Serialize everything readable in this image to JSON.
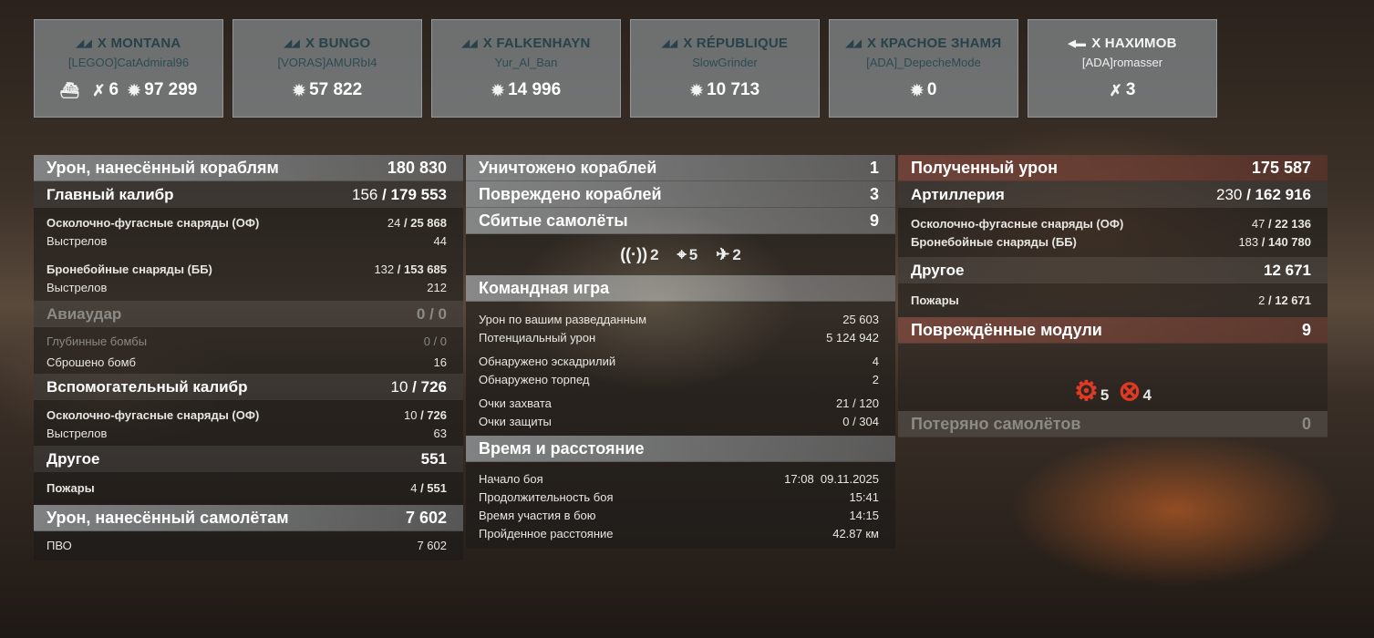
{
  "cards": [
    {
      "tier": "X",
      "ship": "MONTANA",
      "player": "[LEGOO]CatAdmiral96",
      "team": "enemy",
      "class_icon": "battleship-icon",
      "stats": [
        {
          "icon": "sunk-ship-icon",
          "value": ""
        },
        {
          "icon": "plane-shotdown-icon",
          "value": "6"
        },
        {
          "icon": "damage-icon",
          "value": "97 299"
        }
      ]
    },
    {
      "tier": "X",
      "ship": "BUNGO",
      "player": "[VORAS]AMURbI4",
      "team": "enemy",
      "class_icon": "battleship-icon",
      "stats": [
        {
          "icon": "damage-icon",
          "value": "57 822"
        }
      ]
    },
    {
      "tier": "X",
      "ship": "FALKENHAYN",
      "player": "Yur_Al_Ban",
      "team": "enemy",
      "class_icon": "battleship-icon",
      "stats": [
        {
          "icon": "damage-icon",
          "value": "14 996"
        }
      ]
    },
    {
      "tier": "X",
      "ship": "RÉPUBLIQUE",
      "player": "SlowGrinder",
      "team": "enemy",
      "class_icon": "battleship-icon",
      "stats": [
        {
          "icon": "damage-icon",
          "value": "10 713"
        }
      ]
    },
    {
      "tier": "X",
      "ship": "КРАСНОЕ ЗНАМЯ",
      "player": "[ADA]_DepecheMode",
      "team": "enemy",
      "class_icon": "battleship-icon",
      "stats": [
        {
          "icon": "damage-icon",
          "value": "0"
        }
      ]
    },
    {
      "tier": "X",
      "ship": "НАХИМОВ",
      "player": "[ADA]romasser",
      "team": "ally",
      "class_icon": "cruiser-icon",
      "stats": [
        {
          "icon": "plane-shotdown-icon",
          "value": "3"
        }
      ]
    }
  ],
  "left": {
    "h1": {
      "label": "Урон, нанесённый кораблям",
      "value": "180 830"
    },
    "main": {
      "label": "Главный калибр",
      "a": "156",
      "b": "179 553"
    },
    "he": {
      "label": "Осколочно-фугасные снаряды (ОФ)",
      "a": "24",
      "b": "25 868"
    },
    "he_shots": {
      "label": "Выстрелов",
      "value": "44"
    },
    "ap": {
      "label": "Бронебойные снаряды (ББ)",
      "a": "132",
      "b": "153 685"
    },
    "ap_shots": {
      "label": "Выстрелов",
      "value": "212"
    },
    "air": {
      "label": "Авиаудар",
      "value": "0 / 0"
    },
    "depth": {
      "label": "Глубинные бомбы",
      "value": "0 / 0"
    },
    "bombs": {
      "label": "Сброшено бомб",
      "value": "16"
    },
    "sec": {
      "label": "Вспомогательный калибр",
      "a": "10",
      "b": "726"
    },
    "sec_he": {
      "label": "Осколочно-фугасные снаряды (ОФ)",
      "a": "10",
      "b": "726"
    },
    "sec_shots": {
      "label": "Выстрелов",
      "value": "63"
    },
    "other": {
      "label": "Другое",
      "value": "551"
    },
    "fires": {
      "label": "Пожары",
      "a": "4",
      "b": "551"
    },
    "h2": {
      "label": "Урон, нанесённый самолётам",
      "value": "7 602"
    },
    "aa": {
      "label": "ПВО",
      "value": "7 602"
    }
  },
  "mid": {
    "destroyed": {
      "label": "Уничтожено кораблей",
      "value": "1"
    },
    "damaged": {
      "label": "Повреждено кораблей",
      "value": "3"
    },
    "planes": {
      "label": "Сбитые самолёты",
      "value": "9"
    },
    "icons": [
      {
        "icon": "radar-icon",
        "value": "2"
      },
      {
        "icon": "crosshair-icon",
        "value": "5"
      },
      {
        "icon": "fighter-icon",
        "value": "2"
      }
    ],
    "team": {
      "label": "Командная игра"
    },
    "spot_dmg": {
      "label": "Урон по вашим разведданным",
      "value": "25 603"
    },
    "pot_dmg": {
      "label": "Потенциальный урон",
      "value": "5 124 942"
    },
    "sq": {
      "label": "Обнаружено эскадрилий",
      "value": "4"
    },
    "torp": {
      "label": "Обнаружено торпед",
      "value": "2"
    },
    "cap": {
      "label": "Очки захвата",
      "value": "21 / 120"
    },
    "def": {
      "label": "Очки защиты",
      "value": "0 / 304"
    },
    "time": {
      "label": "Время и расстояние"
    },
    "start": {
      "label": "Начало боя",
      "value": "17:08  09.11.2025"
    },
    "dur": {
      "label": "Продолжительность боя",
      "value": "15:41"
    },
    "part": {
      "label": "Время участия в бою",
      "value": "14:15"
    },
    "dist": {
      "label": "Пройденное расстояние",
      "value": "42.87 км"
    }
  },
  "right": {
    "recv": {
      "label": "Полученный урон",
      "value": "175 587"
    },
    "art": {
      "label": "Артиллерия",
      "a": "230",
      "b": "162 916"
    },
    "he": {
      "label": "Осколочно-фугасные снаряды (ОФ)",
      "a": "47",
      "b": "22 136"
    },
    "ap": {
      "label": "Бронебойные снаряды (ББ)",
      "a": "183",
      "b": "140 780"
    },
    "other": {
      "label": "Другое",
      "value": "12 671"
    },
    "fires": {
      "label": "Пожары",
      "a": "2",
      "b": "12 671"
    },
    "mods": {
      "label": "Повреждённые модули",
      "value": "9"
    },
    "mod_icons": [
      {
        "icon": "engine-damage-icon",
        "value": "5"
      },
      {
        "icon": "steering-damage-icon",
        "value": "4"
      }
    ],
    "lost": {
      "label": "Потеряно самолётов",
      "value": "0"
    }
  }
}
